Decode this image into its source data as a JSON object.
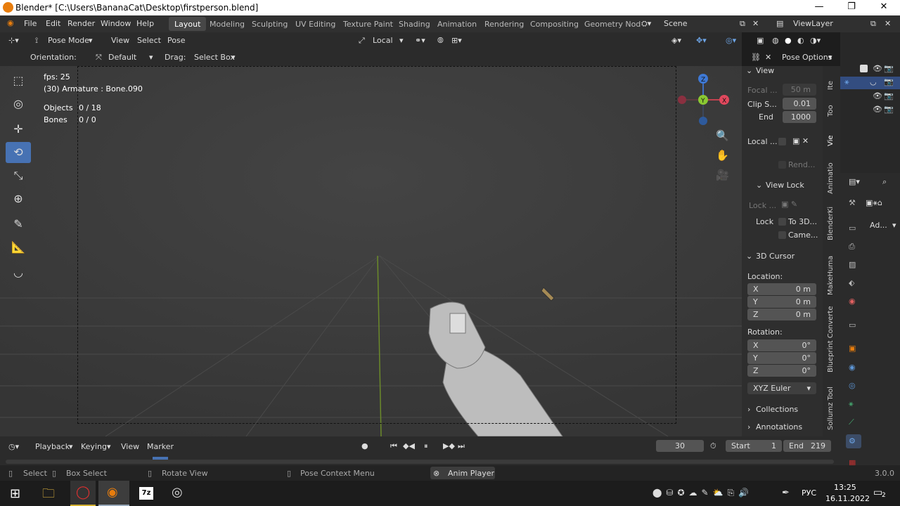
{
  "window": {
    "title": "Blender* [C:\\Users\\BananaCat\\Desktop\\firstperson.blend]",
    "controls": [
      "—",
      "❐",
      "✕"
    ]
  },
  "menu": [
    "File",
    "Edit",
    "Render",
    "Window",
    "Help"
  ],
  "workspaces": [
    "Layout",
    "Modeling",
    "Sculpting",
    "UV Editing",
    "Texture Paint",
    "Shading",
    "Animation",
    "Rendering",
    "Compositing",
    "Geometry Nod"
  ],
  "scene": "Scene",
  "view_layer": "ViewLayer",
  "header": {
    "mode": "Pose Mode",
    "view": "View",
    "select": "Select",
    "pose": "Pose",
    "transform": "Local"
  },
  "header2": {
    "orientation_label": "Orientation:",
    "orientation_value": "Default",
    "drag_label": "Drag:",
    "drag_value": "Select Box",
    "pose_options": "Pose Options"
  },
  "overlay": {
    "fps": "fps: 25",
    "armature": "(30) Armature : Bone.090",
    "objects_label": "Objects",
    "objects_value": "0 / 18",
    "bones_label": "Bones",
    "bones_value": "0 / 0"
  },
  "gizmo": {
    "x": "X",
    "y": "Y",
    "z": "Z"
  },
  "npanel": {
    "view": "View",
    "focal": "Focal ...",
    "focal_val": "50 m",
    "clip": "Clip S...",
    "clip_val": "0.01",
    "end": "End",
    "end_val": "1000",
    "local": "Local ...",
    "rend": "Rend...",
    "view_lock": "View Lock",
    "lock1": "Lock ...",
    "lock2": "Lock",
    "to3d": "To 3D...",
    "came": "Came...",
    "cursor": "3D Cursor",
    "location": "Location:",
    "x": "X",
    "y": "Y",
    "z": "Z",
    "loc_x": "0 m",
    "loc_y": "0 m",
    "loc_z": "0 m",
    "rotation": "Rotation:",
    "rot_x": "0°",
    "rot_y": "0°",
    "rot_z": "0°",
    "euler": "XYZ Euler",
    "collections": "Collections",
    "annotations": "Annotations"
  },
  "vtabs": [
    "Ite",
    "Too",
    "Vie",
    "Animatio",
    "BlenderKi",
    "MakeHuma",
    "Blueprint Converte",
    "Sollumz Tool"
  ],
  "props": {
    "ad": "Ad..."
  },
  "timeline": {
    "playback": "Playback",
    "keying": "Keying",
    "view": "View",
    "marker": "Marker",
    "frame": "30",
    "start_label": "Start",
    "start": "1",
    "end_label": "End",
    "end": "219"
  },
  "status": {
    "select": "Select",
    "box_select": "Box Select",
    "rotate_view": "Rotate View",
    "pose_context": "Pose Context Menu",
    "anim_player": "Anim Player",
    "version": "3.0.0"
  },
  "taskbar": {
    "lang": "РУС",
    "time": "13:25",
    "date": "16.11.2022",
    "notif": "2"
  }
}
